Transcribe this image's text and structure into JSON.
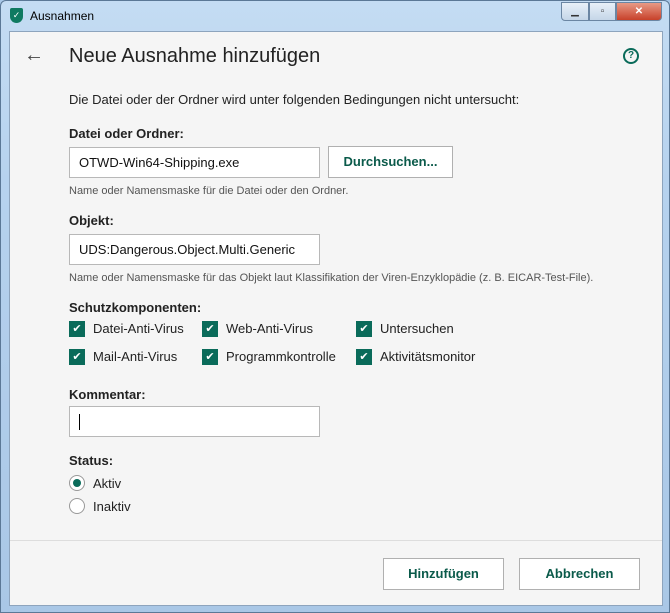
{
  "window": {
    "title": "Ausnahmen"
  },
  "header": {
    "title": "Neue Ausnahme hinzufügen"
  },
  "intro": "Die Datei oder der Ordner wird unter folgenden Bedingungen nicht untersucht:",
  "file": {
    "label": "Datei oder Ordner:",
    "value": "OTWD-Win64-Shipping.exe",
    "browse": "Durchsuchen...",
    "hint": "Name oder Namensmaske für die Datei oder den Ordner."
  },
  "object": {
    "label": "Objekt:",
    "value": "UDS:Dangerous.Object.Multi.Generic",
    "hint": "Name oder Namensmaske für das Objekt laut Klassifikation der Viren-Enzyklopädie (z. B. EICAR-Test-File)."
  },
  "components": {
    "label": "Schutzkomponenten:",
    "items": [
      {
        "label": "Datei-Anti-Virus",
        "checked": true
      },
      {
        "label": "Web-Anti-Virus",
        "checked": true
      },
      {
        "label": "Untersuchen",
        "checked": true
      },
      {
        "label": "Mail-Anti-Virus",
        "checked": true
      },
      {
        "label": "Programmkontrolle",
        "checked": true
      },
      {
        "label": "Aktivitätsmonitor",
        "checked": true
      }
    ]
  },
  "comment": {
    "label": "Kommentar:",
    "value": ""
  },
  "status": {
    "label": "Status:",
    "options": [
      {
        "label": "Aktiv",
        "selected": true
      },
      {
        "label": "Inaktiv",
        "selected": false
      }
    ]
  },
  "footer": {
    "add": "Hinzufügen",
    "cancel": "Abbrechen"
  },
  "colors": {
    "accent": "#0a6b5a"
  }
}
